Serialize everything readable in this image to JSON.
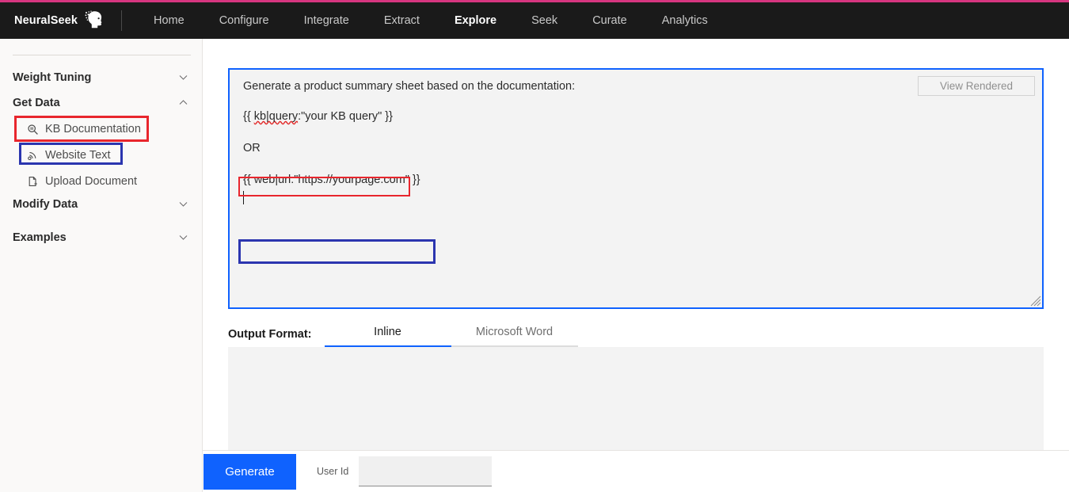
{
  "brand": {
    "name": "NeuralSeek",
    "logo_icon": "brain-head-icon"
  },
  "navbar": {
    "links": [
      {
        "label": "Home",
        "active": false
      },
      {
        "label": "Configure",
        "active": false
      },
      {
        "label": "Integrate",
        "active": false
      },
      {
        "label": "Extract",
        "active": false
      },
      {
        "label": "Explore",
        "active": true
      },
      {
        "label": "Seek",
        "active": false
      },
      {
        "label": "Curate",
        "active": false
      },
      {
        "label": "Analytics",
        "active": false
      }
    ]
  },
  "sidebar": {
    "groups": [
      {
        "label": "Weight Tuning",
        "expanded": false,
        "chevron": "chevron-down-icon"
      },
      {
        "label": "Get Data",
        "expanded": true,
        "chevron": "chevron-up-icon"
      },
      {
        "label": "Modify Data",
        "expanded": false,
        "chevron": "chevron-down-icon"
      },
      {
        "label": "Examples",
        "expanded": false,
        "chevron": "chevron-down-icon"
      }
    ],
    "items": [
      {
        "label": "KB Documentation",
        "icon": "kb-search-icon",
        "highlight": "red"
      },
      {
        "label": "Website Text",
        "icon": "rss-antenna-icon",
        "highlight": "blue"
      },
      {
        "label": "Upload Document",
        "icon": "document-upload-icon",
        "highlight": "none"
      }
    ]
  },
  "annotations": {
    "red_color": "#E8262D",
    "blue_color": "#2B35AF"
  },
  "editor": {
    "prompt_line": "Generate a product summary sheet based on the documentation:",
    "kb_snippet": "{{ kb|query:\"your KB query\" }}",
    "kb_misspelled_part": "kb|query",
    "or_text": "OR",
    "web_snippet": "{{ web|url:\"https://yourpage.com\" }}",
    "view_rendered_label": "View Rendered",
    "view_rendered_disabled": true,
    "border_color": "#0F62FE",
    "resize_grip_icon": "resize-handle-icon"
  },
  "output_format": {
    "label": "Output Format:",
    "tabs": [
      {
        "label": "Inline",
        "active": true
      },
      {
        "label": "Microsoft Word",
        "active": false
      }
    ],
    "active_underline_color": "#0F62FE"
  },
  "output_panel": {
    "content": ""
  },
  "bottom_bar": {
    "generate_label": "Generate",
    "generate_color": "#0F62FE",
    "userid_label": "User Id",
    "userid_value": "",
    "userid_placeholder": ""
  }
}
